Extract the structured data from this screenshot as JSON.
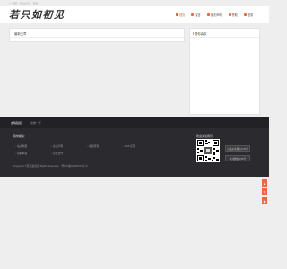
{
  "topline": "M 顶部 · 网站标签 · 服务",
  "logo": "若只如初见",
  "nav": [
    {
      "label": "首页",
      "icon": "home-icon",
      "active": true
    },
    {
      "label": "留言",
      "icon": "message-icon",
      "active": false
    },
    {
      "label": "免责声明",
      "icon": "info-icon",
      "active": false
    },
    {
      "label": "赞助",
      "icon": "gift-icon",
      "active": false
    },
    {
      "label": "登录",
      "icon": "user-icon",
      "active": false
    }
  ],
  "main_box": {
    "title": "最新文章"
  },
  "side_box": {
    "title": "猜你喜欢"
  },
  "friend_links": {
    "label": "友情链接：",
    "link": "交换一下"
  },
  "footer": {
    "title": "猜你相关：",
    "links": [
      "站点地图",
      "免责声明",
      "投稿须知",
      "RSS订阅",
      "赞助本站",
      "商业合作"
    ],
    "copyright": "Copyright ©若只如初见 Rights Reserved.（粤ICP备14016724号-1）",
    "follow_title": "欢迎关注我们：",
    "btn_follow": "扫描关注微信公众号",
    "btn_contact": "关注微信公众号"
  },
  "side_tools": [
    "▲",
    "✎",
    "◆"
  ],
  "colors": {
    "accent": "#e4572e",
    "dark": "#2b2b2f",
    "darker": "#222226"
  }
}
